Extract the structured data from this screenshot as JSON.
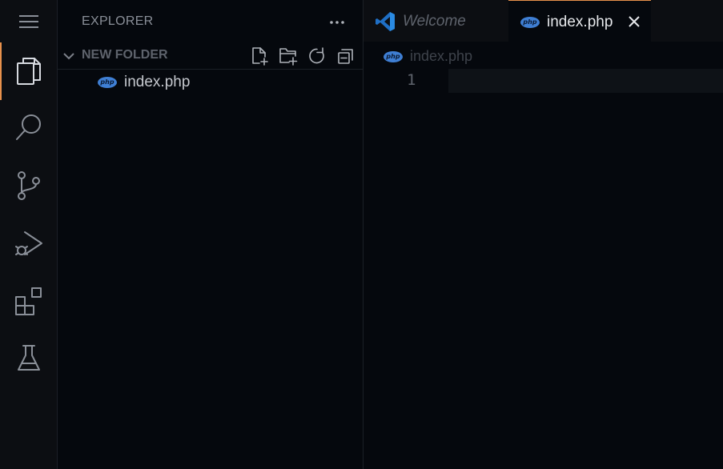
{
  "sidebar": {
    "title": "EXPLORER",
    "folder": "NEW FOLDER",
    "files": [
      {
        "name": "index.php",
        "icon": "php",
        "icon_label": "php"
      }
    ]
  },
  "editor": {
    "tabs": [
      {
        "label": "Welcome",
        "icon": "vscode-logo",
        "active": false
      },
      {
        "label": "index.php",
        "icon": "php",
        "icon_label": "php",
        "active": true
      }
    ],
    "breadcrumb": {
      "file": "index.php",
      "icon_label": "php"
    },
    "line_numbers": [
      "1"
    ]
  },
  "colors": {
    "accent": "#e8914c",
    "php_icon": "#3f7fd4",
    "vscode_blue": "#2a8ae2",
    "background": "#05080d"
  }
}
